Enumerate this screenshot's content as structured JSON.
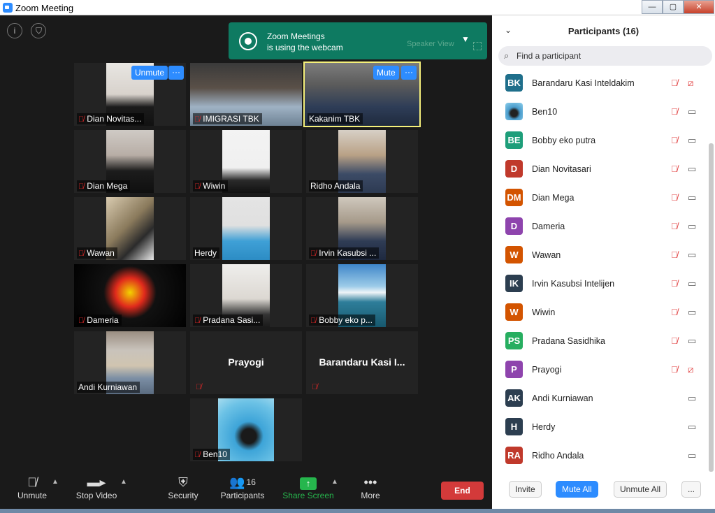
{
  "window": {
    "title": "Zoom Meeting",
    "min": "—",
    "max": "▢",
    "close": "✕"
  },
  "notification": {
    "line1": "Zoom Meetings",
    "line2": "is using the webcam",
    "speaker_view": "Speaker View"
  },
  "tiles": [
    {
      "name": "Dian Novitas...",
      "muted": true
    },
    {
      "name": "IMIGRASI TBK",
      "muted": true
    },
    {
      "name": "Kakanim TBK",
      "muted": false
    },
    {
      "name": "Dian Mega",
      "muted": true
    },
    {
      "name": "Wiwin",
      "muted": true
    },
    {
      "name": "Ridho Andala",
      "muted": false
    },
    {
      "name": "Wawan",
      "muted": true
    },
    {
      "name": "Herdy",
      "muted": false
    },
    {
      "name": "Irvin Kasubsi ...",
      "muted": true
    },
    {
      "name": "Dameria",
      "muted": true
    },
    {
      "name": "Pradana Sasi...",
      "muted": true
    },
    {
      "name": "Bobby eko p...",
      "muted": true
    },
    {
      "name": "Andi Kurniawan",
      "muted": false
    },
    {
      "name": "Prayogi",
      "muted": true
    },
    {
      "name": "Barandaru Kasi I...",
      "muted": true
    },
    {
      "name": "Ben10",
      "muted": true
    }
  ],
  "tile_actions": {
    "unmute": "Unmute",
    "mute": "Mute",
    "more": "···"
  },
  "toolbar": {
    "unmute": "Unmute",
    "stop_video": "Stop Video",
    "security": "Security",
    "participants": "Participants",
    "participants_count": "16",
    "share_screen": "Share Screen",
    "more": "More",
    "end": "End"
  },
  "panel": {
    "title": "Participants (16)",
    "search_placeholder": "Find a participant",
    "invite": "Invite",
    "mute_all": "Mute All",
    "unmute_all": "Unmute All",
    "more": "..."
  },
  "participants": [
    {
      "initials": "BK",
      "name": "Barandaru Kasi Inteldakim",
      "color": "#1f6f8b",
      "mic_muted": true,
      "video_off": true
    },
    {
      "initials": "",
      "name": "Ben10",
      "color": "#4a8fb0",
      "mic_muted": true,
      "video_off": false
    },
    {
      "initials": "BE",
      "name": "Bobby eko putra",
      "color": "#1e9e7a",
      "mic_muted": true,
      "video_off": false
    },
    {
      "initials": "D",
      "name": "Dian Novitasari",
      "color": "#c0392b",
      "mic_muted": true,
      "video_off": false
    },
    {
      "initials": "DM",
      "name": "Dian Mega",
      "color": "#d35400",
      "mic_muted": true,
      "video_off": false
    },
    {
      "initials": "D",
      "name": "Dameria",
      "color": "#8e44ad",
      "mic_muted": true,
      "video_off": false
    },
    {
      "initials": "W",
      "name": "Wawan",
      "color": "#d35400",
      "mic_muted": true,
      "video_off": false
    },
    {
      "initials": "IK",
      "name": "Irvin Kasubsi Intelijen",
      "color": "#2c3e50",
      "mic_muted": true,
      "video_off": false
    },
    {
      "initials": "W",
      "name": "Wiwin",
      "color": "#d35400",
      "mic_muted": true,
      "video_off": false
    },
    {
      "initials": "PS",
      "name": "Pradana Sasidhika",
      "color": "#27ae60",
      "mic_muted": true,
      "video_off": false
    },
    {
      "initials": "P",
      "name": "Prayogi",
      "color": "#8e44ad",
      "mic_muted": true,
      "video_off": true
    },
    {
      "initials": "AK",
      "name": "Andi Kurniawan",
      "color": "#2c3e50",
      "mic_muted": false,
      "video_off": false
    },
    {
      "initials": "H",
      "name": "Herdy",
      "color": "#2c3e50",
      "mic_muted": false,
      "video_off": false
    },
    {
      "initials": "RA",
      "name": "Ridho Andala",
      "color": "#c0392b",
      "mic_muted": false,
      "video_off": false
    }
  ]
}
